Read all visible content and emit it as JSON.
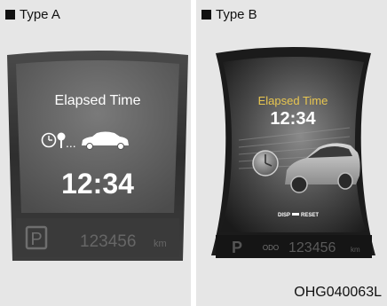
{
  "type_a": {
    "label": "Type A",
    "title": "Elapsed Time",
    "time": "12:34",
    "dots": "...",
    "gear": "P",
    "odometer": "123456",
    "unit": "km"
  },
  "type_b": {
    "label": "Type B",
    "title": "Elapsed Time",
    "time": "12:34",
    "hint_disp": "DISP",
    "hint_reset": "RESET",
    "gear": "P",
    "odo_label": "ODO",
    "odometer": "123456",
    "unit": "km"
  },
  "figure_code": "OHG040063L",
  "colors": {
    "bezel": "#3a3a3a",
    "screen": "#5d5d5d",
    "text": "#ffffff",
    "accent_b": "#e8c650",
    "dim_text": "#7a7a7a"
  },
  "icons": [
    "clock-icon",
    "pin-icon",
    "car-icon",
    "clock-icon",
    "car-icon"
  ]
}
